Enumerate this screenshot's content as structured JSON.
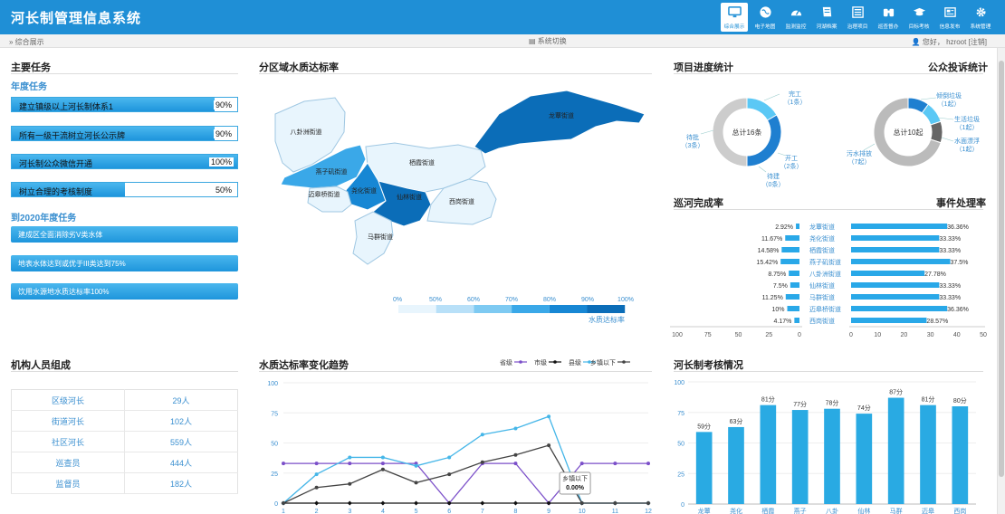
{
  "header": {
    "title": "河长制管理信息系统",
    "nav": [
      {
        "label": "综合展示",
        "icon": "monitor-icon",
        "active": true
      },
      {
        "label": "电子地图",
        "icon": "globe-icon",
        "active": false
      },
      {
        "label": "监测监控",
        "icon": "gauge-icon",
        "active": false
      },
      {
        "label": "河湖档案",
        "icon": "book-icon",
        "active": false
      },
      {
        "label": "治理项目",
        "icon": "list-icon",
        "active": false
      },
      {
        "label": "巡查督办",
        "icon": "binoculars-icon",
        "active": false
      },
      {
        "label": "目标考核",
        "icon": "graduation-cap-icon",
        "active": false
      },
      {
        "label": "信息发布",
        "icon": "newspaper-icon",
        "active": false
      },
      {
        "label": "系统管理",
        "icon": "gear-icon",
        "active": false
      }
    ]
  },
  "subbar": {
    "breadcrumb": "综合展示",
    "system_switch": "系统切换",
    "greeting": "您好，",
    "username": "hzroot",
    "logout": "[注销]"
  },
  "tasks": {
    "title": "主要任务",
    "annual_title": "年度任务",
    "annual": [
      {
        "label": "建立镇级以上河长制体系1",
        "value": 90,
        "text": "90%"
      },
      {
        "label": "所有一级干流树立河长公示牌",
        "value": 90,
        "text": "90%"
      },
      {
        "label": "河长制公众微信开通",
        "value": 100,
        "text": "100%"
      },
      {
        "label": "树立合理的考核制度",
        "value": 50,
        "text": "50%"
      }
    ],
    "y2020_title": "到2020年度任务",
    "y2020": [
      "建成区全面消除劣V类水体",
      "地表水体达到或优于III类达到75%",
      "饮用水源地水质达标率100%"
    ]
  },
  "map": {
    "title": "分区域水质达标率",
    "districts": [
      "龙蕈街道",
      "八卦洲街道",
      "燕子矶街道",
      "栖霞街道",
      "尧化街道",
      "迈皋桥街道",
      "仙林街道",
      "西岗街道",
      "马群街道"
    ],
    "legend_ticks": [
      "0%",
      "50%",
      "60%",
      "70%",
      "80%",
      "90%",
      "100%"
    ],
    "legend_colors": [
      "#e8f5fd",
      "#b8e0f8",
      "#7ecaf2",
      "#3aa8e8",
      "#1787d4",
      "#0b6db8"
    ],
    "legend_title": "水质达标率"
  },
  "progress": {
    "title": "项目进度统计",
    "center": "总计16条",
    "chart_data": {
      "type": "pie",
      "slices": [
        {
          "name": "完工",
          "value": 1,
          "text": "完工（1条）",
          "color": "#5bc8f5"
        },
        {
          "name": "开工",
          "value": 2,
          "text": "开工（2条）",
          "color": "#1f7fd0"
        },
        {
          "name": "待建",
          "value": 0,
          "text": "待建（0条）",
          "color": "#1f7fd0"
        },
        {
          "name": "待批",
          "value": 3,
          "text": "待批（3条）",
          "color": "#cccccc"
        }
      ]
    }
  },
  "complaints": {
    "title": "公众投诉统计",
    "center": "总计10起",
    "chart_data": {
      "type": "pie",
      "slices": [
        {
          "name": "倾倒垃圾",
          "value": 1,
          "text": "倾倒垃圾（1起）",
          "color": "#1f7fd0"
        },
        {
          "name": "生活垃圾",
          "value": 1,
          "text": "生活垃圾（1起）",
          "color": "#5bc8f5"
        },
        {
          "name": "水面漂浮",
          "value": 1,
          "text": "水面漂浮（1起）",
          "color": "#666666"
        },
        {
          "name": "污水排放",
          "value": 7,
          "text": "污水排放（7起）",
          "color": "#bbbbbb"
        }
      ]
    }
  },
  "patrol": {
    "title_left": "巡河完成率",
    "title_right": "事件处理率",
    "chart_data": {
      "type": "bar",
      "categories": [
        "龙蕈街道",
        "尧化街道",
        "栖霞街道",
        "燕子矶街道",
        "八卦洲街道",
        "仙林街道",
        "马群街道",
        "迈皋桥街道",
        "西岗街道"
      ],
      "left_values": [
        2.92,
        11.67,
        14.58,
        15.42,
        8.75,
        7.5,
        11.25,
        10,
        4.17
      ],
      "left_labels": [
        "2.92%",
        "11.67%",
        "14.58%",
        "15.42%",
        "8.75%",
        "7.5%",
        "11.25%",
        "10%",
        "4.17%"
      ],
      "right_values": [
        36.36,
        33.33,
        33.33,
        37.5,
        27.78,
        33.33,
        33.33,
        36.36,
        28.57
      ],
      "right_labels": [
        "36.36%",
        "33.33%",
        "33.33%",
        "37.5%",
        "27.78%",
        "33.33%",
        "33.33%",
        "36.36%",
        "28.57%"
      ],
      "left_axis": [
        "100",
        "75",
        "50",
        "25",
        "0"
      ],
      "right_axis": [
        "0",
        "10",
        "20",
        "30",
        "40",
        "50"
      ],
      "left_max": 100,
      "right_max": 50
    }
  },
  "personnel": {
    "title": "机构人员组成",
    "rows": [
      {
        "role": "区级河长",
        "count": "29人"
      },
      {
        "role": "街道河长",
        "count": "102人"
      },
      {
        "role": "社区河长",
        "count": "559人"
      },
      {
        "role": "巡查员",
        "count": "444人"
      },
      {
        "role": "监督员",
        "count": "182人"
      }
    ]
  },
  "trend": {
    "title": "水质达标率变化趋势",
    "tooltip": {
      "title": "乡镇以下",
      "value": "0.00%"
    },
    "chart_data": {
      "type": "line",
      "x": [
        1,
        2,
        3,
        4,
        5,
        6,
        7,
        8,
        9,
        10,
        11,
        12
      ],
      "ylim": [
        0,
        100
      ],
      "yticks": [
        "0",
        "25",
        "50",
        "75",
        "100"
      ],
      "series": [
        {
          "name": "省级",
          "color": "#7b4fc9",
          "values": [
            33,
            33,
            33,
            33,
            33,
            0,
            33,
            33,
            0,
            33,
            33,
            33
          ]
        },
        {
          "name": "市级",
          "color": "#111111",
          "values": [
            0,
            0,
            0,
            0,
            0,
            0,
            0,
            0,
            0,
            0,
            0,
            0
          ]
        },
        {
          "name": "县级",
          "color": "#45b6e8",
          "values": [
            0,
            24,
            38,
            38,
            31,
            38,
            57,
            62,
            72,
            0,
            0,
            0
          ]
        },
        {
          "name": "乡镇以下",
          "color": "#444444",
          "values": [
            0,
            13,
            16,
            28,
            17,
            24,
            34,
            40,
            48,
            0,
            0,
            0
          ]
        }
      ]
    }
  },
  "assessment": {
    "title": "河长制考核情况",
    "chart_data": {
      "type": "bar",
      "categories": [
        "龙蕈",
        "尧化",
        "栖霞",
        "燕子",
        "八卦",
        "仙林",
        "马群",
        "迈皋",
        "西岗"
      ],
      "values": [
        59,
        63,
        81,
        77,
        78,
        74,
        87,
        81,
        80
      ],
      "labels": [
        "59分",
        "63分",
        "81分",
        "77分",
        "78分",
        "74分",
        "87分",
        "81分",
        "80分"
      ],
      "ylim": [
        0,
        100
      ],
      "yticks": [
        "0",
        "25",
        "50",
        "75",
        "100"
      ]
    }
  }
}
